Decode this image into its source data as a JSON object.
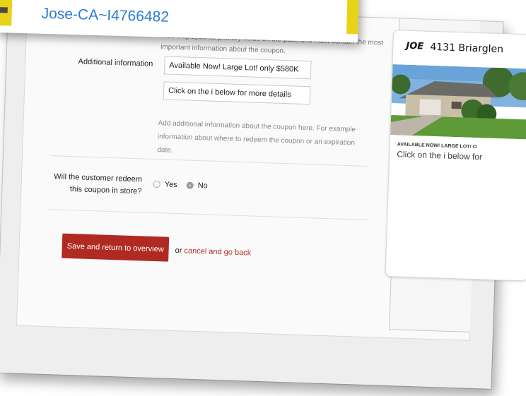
{
  "form": {
    "intro_text": "...be displayed as primary fields on the pass and must contain the most important information about the coupon.",
    "additional_info_label": "Additional information",
    "field1_value": "Available Now! Large Lot! only $580K",
    "field2_value": "Click on the i  below for more details",
    "help_text": "Add additional information about the coupon here. For example information about where to redeem the coupon or an expiration date.",
    "redeem_question_line1": "Will the customer redeem",
    "redeem_question_line2": "this coupon in store?",
    "radio_yes_label": "Yes",
    "radio_no_label": "No",
    "selected": "No",
    "save_button_label": "Save and return to overview",
    "or_text": "or",
    "cancel_link_label": "cancel and go back"
  },
  "preview": {
    "logo_text": "JOE",
    "title": "4131 Briarglen",
    "primary_field": "AVAILABLE NOW! LARGE LOT! O",
    "secondary_field": "Click on the i below for"
  },
  "topbar": {
    "title_text": "Jose-CA~I4766482"
  },
  "colors": {
    "accent_red": "#b02a22",
    "link_blue": "#2a7bd5",
    "strip_yellow": "#e8d317"
  }
}
